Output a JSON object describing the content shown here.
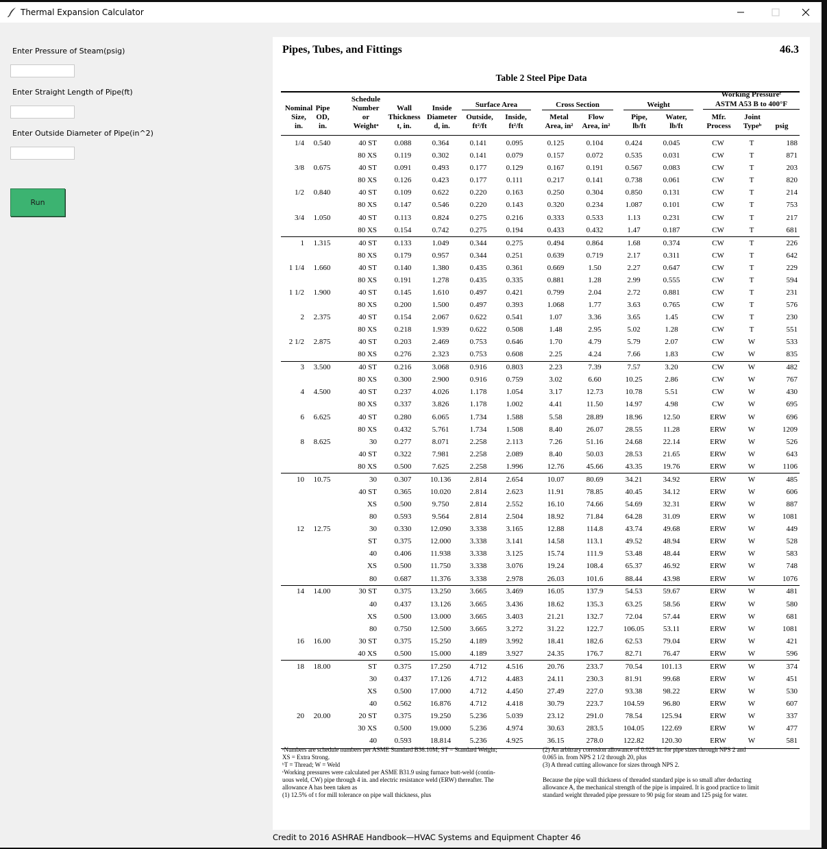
{
  "window": {
    "title": "Thermal Expansion Calculator"
  },
  "form": {
    "pressure_label": "Enter Pressure of Steam(psig)",
    "length_label": "Enter Straight Length of Pipe(ft)",
    "diameter_label": "Enter Outside Diameter of Pipe(in^2)",
    "pressure_value": "",
    "length_value": "",
    "diameter_value": "",
    "run_label": "Run"
  },
  "document": {
    "chapter_title": "Pipes, Tubes, and Fittings",
    "page_number": "46.3",
    "table_title": "Table 2   Steel Pipe Data",
    "headers": {
      "nominal": [
        "Nominal",
        "Size,",
        "in."
      ],
      "pipe_od": [
        "Pipe",
        "OD,",
        "in."
      ],
      "schedule": [
        "Schedule",
        "Number",
        "or",
        "Weightᵃ"
      ],
      "wall": [
        "Wall",
        "Thickness",
        "t, in."
      ],
      "inside": [
        "Inside",
        "Diameter",
        "d, in."
      ],
      "surface_area": "Surface Area",
      "outside": [
        "Outside,",
        "ft²/ft"
      ],
      "inside_sa": [
        "Inside,",
        "ft²/ft"
      ],
      "cross_section": "Cross Section",
      "metal": [
        "Metal",
        "Area, in²"
      ],
      "flow": [
        "Flow",
        "Area, in²"
      ],
      "weight": "Weight",
      "pipe_w": [
        "Pipe,",
        "lb/ft"
      ],
      "water_w": [
        "Water,",
        "lb/ft"
      ],
      "working_pressure": [
        "Working Pressureᶜ",
        "ASTM A53 B to 400°F"
      ],
      "mfr": [
        "Mfr.",
        "Process"
      ],
      "joint": [
        "Joint",
        "Typeᵇ"
      ],
      "psig": "psig"
    },
    "rows": [
      [
        "1/4",
        "0.540",
        "40 ST",
        "0.088",
        "0.364",
        "0.141",
        "0.095",
        "0.125",
        "0.104",
        "0.424",
        "0.045",
        "CW",
        "T",
        "188"
      ],
      [
        "",
        "",
        "80 XS",
        "0.119",
        "0.302",
        "0.141",
        "0.079",
        "0.157",
        "0.072",
        "0.535",
        "0.031",
        "CW",
        "T",
        "871"
      ],
      [
        "3/8",
        "0.675",
        "40 ST",
        "0.091",
        "0.493",
        "0.177",
        "0.129",
        "0.167",
        "0.191",
        "0.567",
        "0.083",
        "CW",
        "T",
        "203"
      ],
      [
        "",
        "",
        "80 XS",
        "0.126",
        "0.423",
        "0.177",
        "0.111",
        "0.217",
        "0.141",
        "0.738",
        "0.061",
        "CW",
        "T",
        "820"
      ],
      [
        "1/2",
        "0.840",
        "40 ST",
        "0.109",
        "0.622",
        "0.220",
        "0.163",
        "0.250",
        "0.304",
        "0.850",
        "0.131",
        "CW",
        "T",
        "214"
      ],
      [
        "",
        "",
        "80 XS",
        "0.147",
        "0.546",
        "0.220",
        "0.143",
        "0.320",
        "0.234",
        "1.087",
        "0.101",
        "CW",
        "T",
        "753"
      ],
      [
        "3/4",
        "1.050",
        "40 ST",
        "0.113",
        "0.824",
        "0.275",
        "0.216",
        "0.333",
        "0.533",
        "1.13",
        "0.231",
        "CW",
        "T",
        "217"
      ],
      [
        "",
        "",
        "80 XS",
        "0.154",
        "0.742",
        "0.275",
        "0.194",
        "0.433",
        "0.432",
        "1.47",
        "0.187",
        "CW",
        "T",
        "681"
      ],
      [
        "1",
        "1.315",
        "40 ST",
        "0.133",
        "1.049",
        "0.344",
        "0.275",
        "0.494",
        "0.864",
        "1.68",
        "0.374",
        "CW",
        "T",
        "226"
      ],
      [
        "",
        "",
        "80 XS",
        "0.179",
        "0.957",
        "0.344",
        "0.251",
        "0.639",
        "0.719",
        "2.17",
        "0.311",
        "CW",
        "T",
        "642"
      ],
      [
        "1 1/4",
        "1.660",
        "40 ST",
        "0.140",
        "1.380",
        "0.435",
        "0.361",
        "0.669",
        "1.50",
        "2.27",
        "0.647",
        "CW",
        "T",
        "229"
      ],
      [
        "",
        "",
        "80 XS",
        "0.191",
        "1.278",
        "0.435",
        "0.335",
        "0.881",
        "1.28",
        "2.99",
        "0.555",
        "CW",
        "T",
        "594"
      ],
      [
        "1 1/2",
        "1.900",
        "40 ST",
        "0.145",
        "1.610",
        "0.497",
        "0.421",
        "0.799",
        "2.04",
        "2.72",
        "0.881",
        "CW",
        "T",
        "231"
      ],
      [
        "",
        "",
        "80 XS",
        "0.200",
        "1.500",
        "0.497",
        "0.393",
        "1.068",
        "1.77",
        "3.63",
        "0.765",
        "CW",
        "T",
        "576"
      ],
      [
        "2",
        "2.375",
        "40 ST",
        "0.154",
        "2.067",
        "0.622",
        "0.541",
        "1.07",
        "3.36",
        "3.65",
        "1.45",
        "CW",
        "T",
        "230"
      ],
      [
        "",
        "",
        "80 XS",
        "0.218",
        "1.939",
        "0.622",
        "0.508",
        "1.48",
        "2.95",
        "5.02",
        "1.28",
        "CW",
        "T",
        "551"
      ],
      [
        "2 1/2",
        "2.875",
        "40 ST",
        "0.203",
        "2.469",
        "0.753",
        "0.646",
        "1.70",
        "4.79",
        "5.79",
        "2.07",
        "CW",
        "W",
        "533"
      ],
      [
        "",
        "",
        "80 XS",
        "0.276",
        "2.323",
        "0.753",
        "0.608",
        "2.25",
        "4.24",
        "7.66",
        "1.83",
        "CW",
        "W",
        "835"
      ],
      [
        "3",
        "3.500",
        "40 ST",
        "0.216",
        "3.068",
        "0.916",
        "0.803",
        "2.23",
        "7.39",
        "7.57",
        "3.20",
        "CW",
        "W",
        "482"
      ],
      [
        "",
        "",
        "80 XS",
        "0.300",
        "2.900",
        "0.916",
        "0.759",
        "3.02",
        "6.60",
        "10.25",
        "2.86",
        "CW",
        "W",
        "767"
      ],
      [
        "4",
        "4.500",
        "40 ST",
        "0.237",
        "4.026",
        "1.178",
        "1.054",
        "3.17",
        "12.73",
        "10.78",
        "5.51",
        "CW",
        "W",
        "430"
      ],
      [
        "",
        "",
        "80 XS",
        "0.337",
        "3.826",
        "1.178",
        "1.002",
        "4.41",
        "11.50",
        "14.97",
        "4.98",
        "CW",
        "W",
        "695"
      ],
      [
        "6",
        "6.625",
        "40 ST",
        "0.280",
        "6.065",
        "1.734",
        "1.588",
        "5.58",
        "28.89",
        "18.96",
        "12.50",
        "ERW",
        "W",
        "696"
      ],
      [
        "",
        "",
        "80 XS",
        "0.432",
        "5.761",
        "1.734",
        "1.508",
        "8.40",
        "26.07",
        "28.55",
        "11.28",
        "ERW",
        "W",
        "1209"
      ],
      [
        "8",
        "8.625",
        "30",
        "0.277",
        "8.071",
        "2.258",
        "2.113",
        "7.26",
        "51.16",
        "24.68",
        "22.14",
        "ERW",
        "W",
        "526"
      ],
      [
        "",
        "",
        "40 ST",
        "0.322",
        "7.981",
        "2.258",
        "2.089",
        "8.40",
        "50.03",
        "28.53",
        "21.65",
        "ERW",
        "W",
        "643"
      ],
      [
        "",
        "",
        "80 XS",
        "0.500",
        "7.625",
        "2.258",
        "1.996",
        "12.76",
        "45.66",
        "43.35",
        "19.76",
        "ERW",
        "W",
        "1106"
      ],
      [
        "10",
        "10.75",
        "30",
        "0.307",
        "10.136",
        "2.814",
        "2.654",
        "10.07",
        "80.69",
        "34.21",
        "34.92",
        "ERW",
        "W",
        "485"
      ],
      [
        "",
        "",
        "40 ST",
        "0.365",
        "10.020",
        "2.814",
        "2.623",
        "11.91",
        "78.85",
        "40.45",
        "34.12",
        "ERW",
        "W",
        "606"
      ],
      [
        "",
        "",
        "XS",
        "0.500",
        "9.750",
        "2.814",
        "2.552",
        "16.10",
        "74.66",
        "54.69",
        "32.31",
        "ERW",
        "W",
        "887"
      ],
      [
        "",
        "",
        "80",
        "0.593",
        "9.564",
        "2.814",
        "2.504",
        "18.92",
        "71.84",
        "64.28",
        "31.09",
        "ERW",
        "W",
        "1081"
      ],
      [
        "12",
        "12.75",
        "30",
        "0.330",
        "12.090",
        "3.338",
        "3.165",
        "12.88",
        "114.8",
        "43.74",
        "49.68",
        "ERW",
        "W",
        "449"
      ],
      [
        "",
        "",
        "ST",
        "0.375",
        "12.000",
        "3.338",
        "3.141",
        "14.58",
        "113.1",
        "49.52",
        "48.94",
        "ERW",
        "W",
        "528"
      ],
      [
        "",
        "",
        "40",
        "0.406",
        "11.938",
        "3.338",
        "3.125",
        "15.74",
        "111.9",
        "53.48",
        "48.44",
        "ERW",
        "W",
        "583"
      ],
      [
        "",
        "",
        "XS",
        "0.500",
        "11.750",
        "3.338",
        "3.076",
        "19.24",
        "108.4",
        "65.37",
        "46.92",
        "ERW",
        "W",
        "748"
      ],
      [
        "",
        "",
        "80",
        "0.687",
        "11.376",
        "3.338",
        "2.978",
        "26.03",
        "101.6",
        "88.44",
        "43.98",
        "ERW",
        "W",
        "1076"
      ],
      [
        "14",
        "14.00",
        "30 ST",
        "0.375",
        "13.250",
        "3.665",
        "3.469",
        "16.05",
        "137.9",
        "54.53",
        "59.67",
        "ERW",
        "W",
        "481"
      ],
      [
        "",
        "",
        "40",
        "0.437",
        "13.126",
        "3.665",
        "3.436",
        "18.62",
        "135.3",
        "63.25",
        "58.56",
        "ERW",
        "W",
        "580"
      ],
      [
        "",
        "",
        "XS",
        "0.500",
        "13.000",
        "3.665",
        "3.403",
        "21.21",
        "132.7",
        "72.04",
        "57.44",
        "ERW",
        "W",
        "681"
      ],
      [
        "",
        "",
        "80",
        "0.750",
        "12.500",
        "3.665",
        "3.272",
        "31.22",
        "122.7",
        "106.05",
        "53.11",
        "ERW",
        "W",
        "1081"
      ],
      [
        "16",
        "16.00",
        "30 ST",
        "0.375",
        "15.250",
        "4.189",
        "3.992",
        "18.41",
        "182.6",
        "62.53",
        "79.04",
        "ERW",
        "W",
        "421"
      ],
      [
        "",
        "",
        "40 XS",
        "0.500",
        "15.000",
        "4.189",
        "3.927",
        "24.35",
        "176.7",
        "82.71",
        "76.47",
        "ERW",
        "W",
        "596"
      ],
      [
        "18",
        "18.00",
        "ST",
        "0.375",
        "17.250",
        "4.712",
        "4.516",
        "20.76",
        "233.7",
        "70.54",
        "101.13",
        "ERW",
        "W",
        "374"
      ],
      [
        "",
        "",
        "30",
        "0.437",
        "17.126",
        "4.712",
        "4.483",
        "24.11",
        "230.3",
        "81.91",
        "99.68",
        "ERW",
        "W",
        "451"
      ],
      [
        "",
        "",
        "XS",
        "0.500",
        "17.000",
        "4.712",
        "4.450",
        "27.49",
        "227.0",
        "93.38",
        "98.22",
        "ERW",
        "W",
        "530"
      ],
      [
        "",
        "",
        "40",
        "0.562",
        "16.876",
        "4.712",
        "4.418",
        "30.79",
        "223.7",
        "104.59",
        "96.80",
        "ERW",
        "W",
        "607"
      ],
      [
        "20",
        "20.00",
        "20 ST",
        "0.375",
        "19.250",
        "5.236",
        "5.039",
        "23.12",
        "291.0",
        "78.54",
        "125.94",
        "ERW",
        "W",
        "337"
      ],
      [
        "",
        "",
        "30 XS",
        "0.500",
        "19.000",
        "5.236",
        "4.974",
        "30.63",
        "283.5",
        "104.05",
        "122.69",
        "ERW",
        "W",
        "477"
      ],
      [
        "",
        "",
        "40",
        "0.593",
        "18.814",
        "5.236",
        "4.925",
        "36.15",
        "278.0",
        "122.82",
        "120.30",
        "ERW",
        "W",
        "581"
      ]
    ],
    "group_separators_after": [
      7,
      17,
      26,
      35,
      41
    ],
    "footnotes_left": [
      "ᵃNumbers are schedule numbers per ASME Standard B36.10M; ST = Standard Weight;",
      "  XS = Extra Strong.",
      "ᵇT = Thread; W = Weld",
      "ᶜWorking pressures were calculated per ASME B31.9 using furnace butt-weld (contin-",
      "  uous weld, CW) pipe through 4 in. and electric resistance weld (ERW) thereafter. The",
      "  allowance A has been taken as",
      "(1) 12.5% of t for mill tolerance on pipe wall thickness, plus"
    ],
    "footnotes_right": [
      "(2) An arbitrary corrosion allowance of 0.025 in. for pipe sizes through NPS 2 and",
      "      0.065 in. from NPS 2 1/2 through 20, plus",
      "(3) A thread cutting allowance for sizes through NPS 2.",
      "",
      "Because the pipe wall thickness of threaded standard pipe is so small after deducting",
      "allowance A, the mechanical strength of the pipe is impaired. It is good practice to limit",
      "standard weight threaded pipe pressure to 90 psig for steam and 125 psig for water."
    ]
  },
  "credit": "Credit to 2016 ASHRAE Handbook—HVAC Systems and Equipment Chapter 46"
}
